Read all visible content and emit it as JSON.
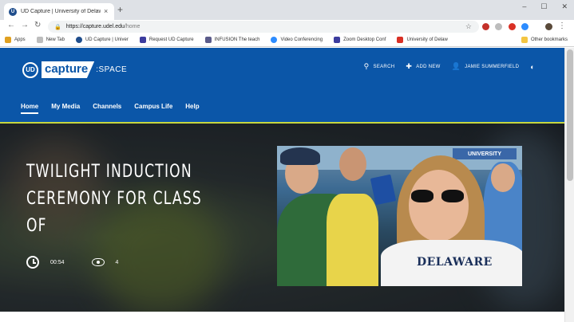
{
  "browser": {
    "tab_title": "UD Capture | University of Delaw",
    "tab_close": "×",
    "new_tab": "+",
    "url_domain": "https://capture.udel.edu",
    "url_path": "/home",
    "win_controls": [
      "–",
      "☐",
      "✕"
    ],
    "bookmarks": [
      {
        "label": "Apps",
        "color": "#e0a020"
      },
      {
        "label": "New Tab",
        "color": "#bdbdbd"
      },
      {
        "label": "UD Capture | Univer",
        "color": "#1f4d8c"
      },
      {
        "label": "Request UD Capture",
        "color": "#3c3c9e"
      },
      {
        "label": "INFUSION The teach",
        "color": "#5b5b8a"
      },
      {
        "label": "Video Conferencing",
        "color": "#2d8cff"
      },
      {
        "label": "Zoom Desktop Conf",
        "color": "#3c3c9e"
      },
      {
        "label": "University of Delaw",
        "color": "#d93025"
      }
    ],
    "other_bookmarks": "Other bookmarks"
  },
  "site": {
    "logo_ud": "UD",
    "logo_capture": "capture",
    "logo_space": ":SPACE",
    "actions": {
      "search": "SEARCH",
      "add_new": "ADD NEW",
      "user": "JAMIE SUMMERFIELD"
    },
    "nav": [
      "Home",
      "My Media",
      "Channels",
      "Campus Life",
      "Help"
    ],
    "accent": "#0b56a8",
    "stripe": "#c6d63f"
  },
  "hero": {
    "title_line1": "TWILIGHT INDUCTION",
    "title_line2": "CEREMONY FOR CLASS OF",
    "duration": "00:54",
    "views": "4",
    "thumb_shirt": "DELAWARE",
    "thumb_banner": "UNIVERSITY"
  }
}
